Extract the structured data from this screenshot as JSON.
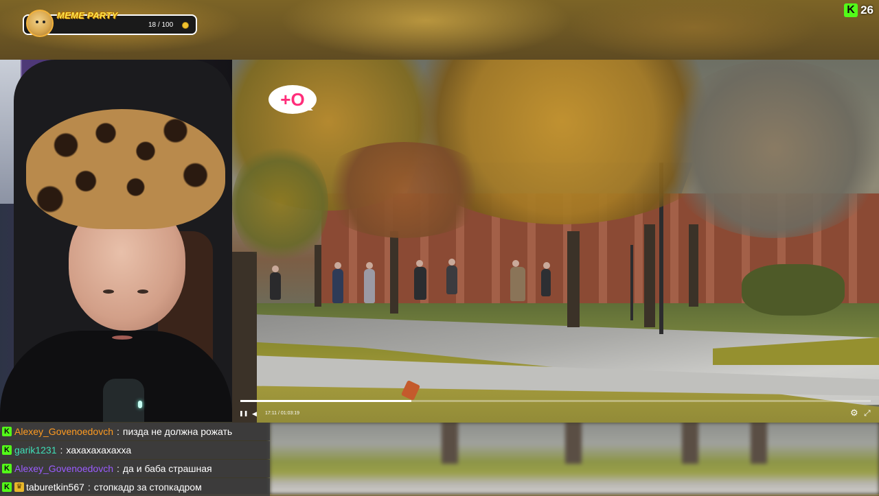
{
  "overlay": {
    "meme_title": "MEME PARTY",
    "meme_progress_text": "18 / 100",
    "meme_progress_fraction": 0.18,
    "coin_icon": "coin-icon",
    "viewers_logo": "K",
    "viewers_count": "26"
  },
  "player": {
    "channel_logo_text": "+O",
    "elapsed": "17:11",
    "duration": "01:03:19",
    "time_display": "17:11 / 01:03:19",
    "progress_fraction": 0.271,
    "icons": {
      "pause": "pause-icon",
      "volume": "volume-icon",
      "settings": "gear-icon",
      "fullscreen": "fullscreen-icon"
    },
    "glyphs": {
      "pause": "❚❚",
      "volume": "◀",
      "settings": "⚙",
      "fullscreen": "⤢"
    }
  },
  "chat": {
    "messages": [
      {
        "user": "Alexey_Govenoedovch",
        "user_color": "#ff9b21",
        "text": "пизда не должна рожать",
        "badges": [
          "K"
        ]
      },
      {
        "user": "garik1231",
        "user_color": "#3fe0b8",
        "text": "хахахахахахха",
        "badges": [
          "K"
        ]
      },
      {
        "user": "Alexey_Govenoedovch",
        "user_color": "#9b5cff",
        "text": "да и баба страшная",
        "badges": [
          "K"
        ]
      },
      {
        "user": "taburetkin567",
        "user_color": "#ffffff",
        "text": "стопкадр за стопкадром",
        "badges": [
          "K",
          "crown"
        ]
      }
    ]
  },
  "colors": {
    "accent_green": "#53fc18",
    "meme_yellow": "#ffe54a",
    "channel_pink": "#ff2d7a"
  }
}
